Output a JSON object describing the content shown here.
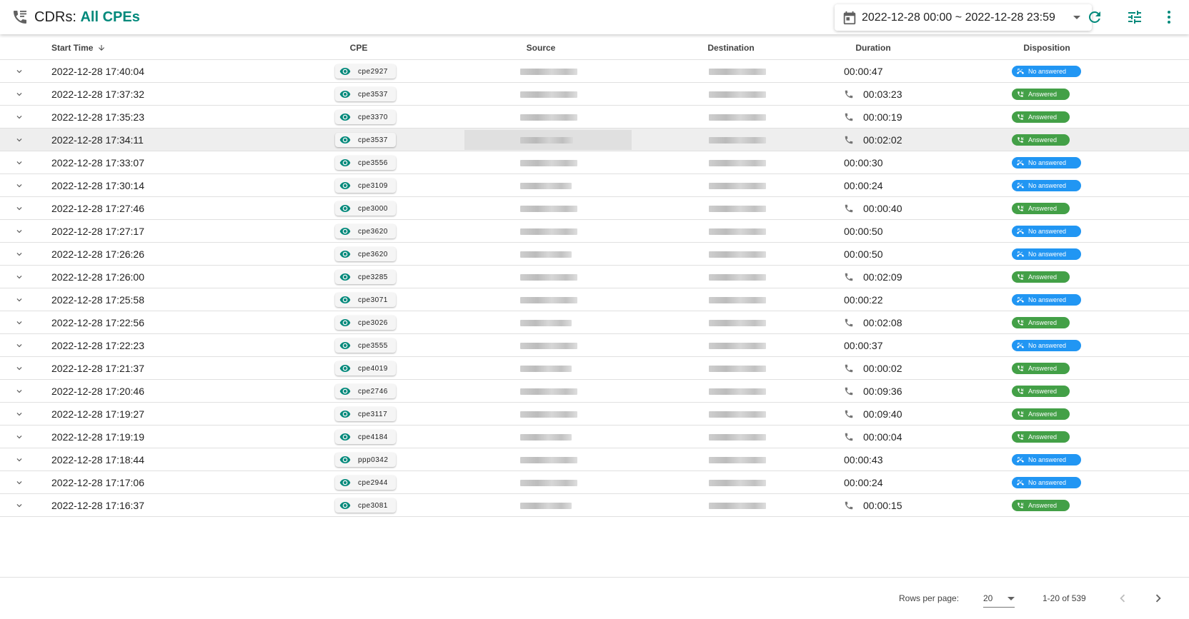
{
  "header": {
    "title_prefix": "CDRs: ",
    "title_accent": "All CPEs",
    "date_range": "2022-12-28 00:00 ~ 2022-12-28 23:59",
    "icons": [
      "phone-log-icon",
      "calendar-icon",
      "refresh-icon",
      "tune-icon",
      "more-vert-icon"
    ]
  },
  "colors": {
    "accent": "#00897b",
    "answered": "#43a047",
    "no_answered": "#2196f3"
  },
  "table": {
    "columns": {
      "start_time": "Start Time",
      "cpe": "CPE",
      "source": "Source",
      "destination": "Destination",
      "duration": "Duration",
      "disposition": "Disposition"
    },
    "sort": {
      "column": "Start Time",
      "direction": "descending"
    },
    "rows": [
      {
        "start": "2022-12-28 17:40:04",
        "cpe": "cpe2927",
        "duration": "00:00:47",
        "disposition": "No answered"
      },
      {
        "start": "2022-12-28 17:37:32",
        "cpe": "cpe3537",
        "duration": "00:03:23",
        "disposition": "Answered"
      },
      {
        "start": "2022-12-28 17:35:23",
        "cpe": "cpe3370",
        "duration": "00:00:19",
        "disposition": "Answered"
      },
      {
        "start": "2022-12-28 17:34:11",
        "cpe": "cpe3537",
        "duration": "00:02:02",
        "disposition": "Answered"
      },
      {
        "start": "2022-12-28 17:33:07",
        "cpe": "cpe3556",
        "duration": "00:00:30",
        "disposition": "No answered"
      },
      {
        "start": "2022-12-28 17:30:14",
        "cpe": "cpe3109",
        "duration": "00:00:24",
        "disposition": "No answered"
      },
      {
        "start": "2022-12-28 17:27:46",
        "cpe": "cpe3000",
        "duration": "00:00:40",
        "disposition": "Answered"
      },
      {
        "start": "2022-12-28 17:27:17",
        "cpe": "cpe3620",
        "duration": "00:00:50",
        "disposition": "No answered"
      },
      {
        "start": "2022-12-28 17:26:26",
        "cpe": "cpe3620",
        "duration": "00:00:50",
        "disposition": "No answered"
      },
      {
        "start": "2022-12-28 17:26:00",
        "cpe": "cpe3285",
        "duration": "00:02:09",
        "disposition": "Answered"
      },
      {
        "start": "2022-12-28 17:25:58",
        "cpe": "cpe3071",
        "duration": "00:00:22",
        "disposition": "No answered"
      },
      {
        "start": "2022-12-28 17:22:56",
        "cpe": "cpe3026",
        "duration": "00:02:08",
        "disposition": "Answered"
      },
      {
        "start": "2022-12-28 17:22:23",
        "cpe": "cpe3555",
        "duration": "00:00:37",
        "disposition": "No answered"
      },
      {
        "start": "2022-12-28 17:21:37",
        "cpe": "cpe4019",
        "duration": "00:00:02",
        "disposition": "Answered"
      },
      {
        "start": "2022-12-28 17:20:46",
        "cpe": "cpe2746",
        "duration": "00:09:36",
        "disposition": "Answered"
      },
      {
        "start": "2022-12-28 17:19:27",
        "cpe": "cpe3117",
        "duration": "00:09:40",
        "disposition": "Answered"
      },
      {
        "start": "2022-12-28 17:19:19",
        "cpe": "cpe4184",
        "duration": "00:00:04",
        "disposition": "Answered"
      },
      {
        "start": "2022-12-28 17:18:44",
        "cpe": "ppp0342",
        "duration": "00:00:43",
        "disposition": "No answered"
      },
      {
        "start": "2022-12-28 17:17:06",
        "cpe": "cpe2944",
        "duration": "00:00:24",
        "disposition": "No answered"
      },
      {
        "start": "2022-12-28 17:16:37",
        "cpe": "cpe3081",
        "duration": "00:00:15",
        "disposition": "Answered"
      }
    ]
  },
  "footer": {
    "rows_per_page_label": "Rows per page:",
    "rows_per_page_value": "20",
    "range_text": "1-20 of 539"
  }
}
